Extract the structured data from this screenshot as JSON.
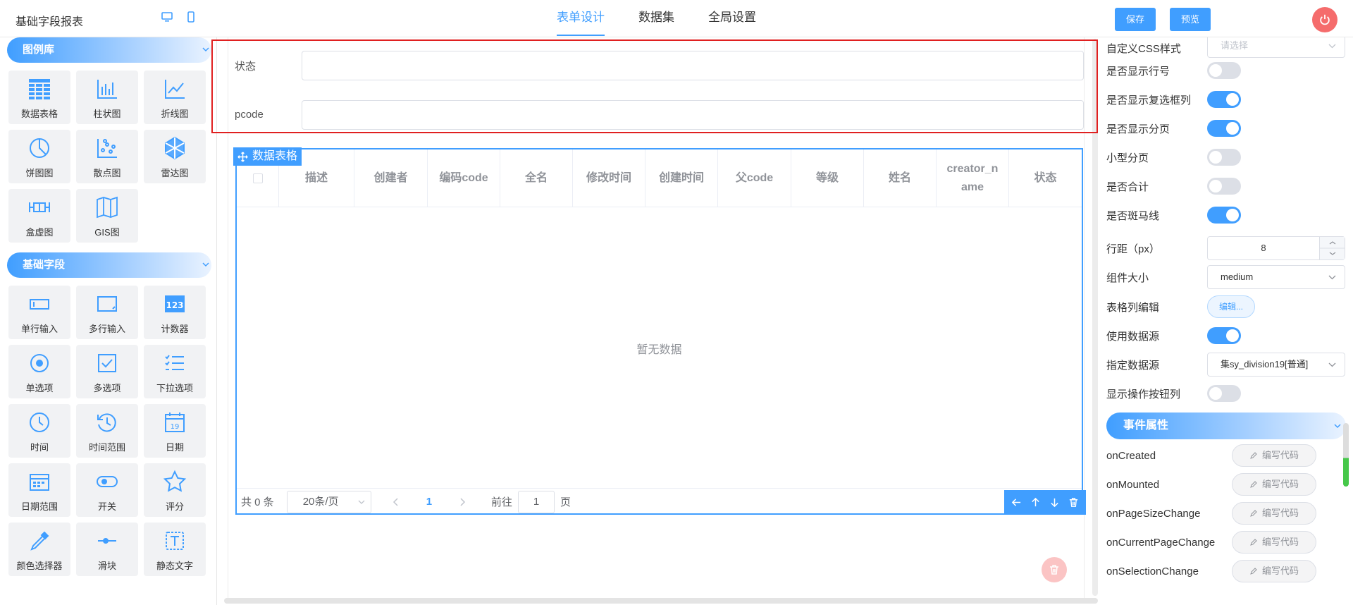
{
  "header": {
    "title": "基础字段报表",
    "tabs": [
      {
        "label": "表单设计",
        "active": true
      },
      {
        "label": "数据集",
        "active": false
      },
      {
        "label": "全局设置",
        "active": false
      }
    ],
    "save_label": "保存",
    "preview_label": "预览",
    "accent": "#409eff",
    "danger": "#f56c6c"
  },
  "sidebar": {
    "chart_section": "图例库",
    "chart_items": [
      {
        "label": "数据表格",
        "icon": "table-icon"
      },
      {
        "label": "柱状图",
        "icon": "bar-chart-icon"
      },
      {
        "label": "折线图",
        "icon": "line-chart-icon"
      },
      {
        "label": "饼图图",
        "icon": "pie-chart-icon"
      },
      {
        "label": "散点图",
        "icon": "scatter-icon"
      },
      {
        "label": "雷达图",
        "icon": "radar-icon"
      },
      {
        "label": "盒虚图",
        "icon": "boxplot-icon"
      },
      {
        "label": "GIS图",
        "icon": "map-icon"
      }
    ],
    "field_section": "基础字段",
    "field_items": [
      {
        "label": "单行输入",
        "icon": "input-icon"
      },
      {
        "label": "多行输入",
        "icon": "textarea-icon"
      },
      {
        "label": "计数器",
        "icon": "counter-icon"
      },
      {
        "label": "单选项",
        "icon": "radio-icon"
      },
      {
        "label": "多选项",
        "icon": "checkbox-icon"
      },
      {
        "label": "下拉选项",
        "icon": "select-icon"
      },
      {
        "label": "时间",
        "icon": "clock-icon"
      },
      {
        "label": "时间范围",
        "icon": "time-range-icon"
      },
      {
        "label": "日期",
        "icon": "calendar-icon"
      },
      {
        "label": "日期范围",
        "icon": "date-range-icon"
      },
      {
        "label": "开关",
        "icon": "switch-icon"
      },
      {
        "label": "评分",
        "icon": "star-icon"
      },
      {
        "label": "颜色选择器",
        "icon": "color-picker-icon"
      },
      {
        "label": "滑块",
        "icon": "slider-icon"
      },
      {
        "label": "静态文字",
        "icon": "text-icon"
      }
    ]
  },
  "canvas": {
    "form_fields": [
      {
        "label": "状态",
        "value": ""
      },
      {
        "label": "pcode",
        "value": ""
      }
    ],
    "table": {
      "tag": "数据表格",
      "columns": [
        "描述",
        "创建者",
        "编码code",
        "全名",
        "修改时间",
        "创建时间",
        "父code",
        "等级",
        "姓名",
        "creator_n ame",
        "状态"
      ],
      "empty_text": "暂无数据",
      "total": "共 0 条",
      "page_size": "20条/页",
      "current_page": "1",
      "goto_label": "前往",
      "goto_value": "1",
      "page_suffix": "页"
    }
  },
  "props": {
    "css_label": "自定义CSS样式",
    "css_placeholder": "请选择",
    "show_row_num": "是否显示行号",
    "show_checkbox_col": "是否显示复选框列",
    "show_pagination": "是否显示分页",
    "small_pagination": "小型分页",
    "show_summary": "是否合计",
    "stripe": "是否斑马线",
    "row_spacing_label": "行距（px）",
    "row_spacing_value": "8",
    "size_label": "组件大小",
    "size_value": "medium",
    "col_edit_label": "表格列编辑",
    "col_edit_button": "编辑...",
    "use_ds_label": "使用数据源",
    "ds_label": "指定数据源",
    "ds_value": "集sy_division19[普通]",
    "op_col_label": "显示操作按钮列",
    "events_section": "事件属性",
    "events": [
      "onCreated",
      "onMounted",
      "onPageSizeChange",
      "onCurrentPageChange",
      "onSelectionChange"
    ],
    "code_button": "编写代码",
    "switches": {
      "row_num": false,
      "checkbox_col": true,
      "pagination": true,
      "small": false,
      "summary": false,
      "stripe": true,
      "use_ds": true,
      "op_col": false
    }
  }
}
